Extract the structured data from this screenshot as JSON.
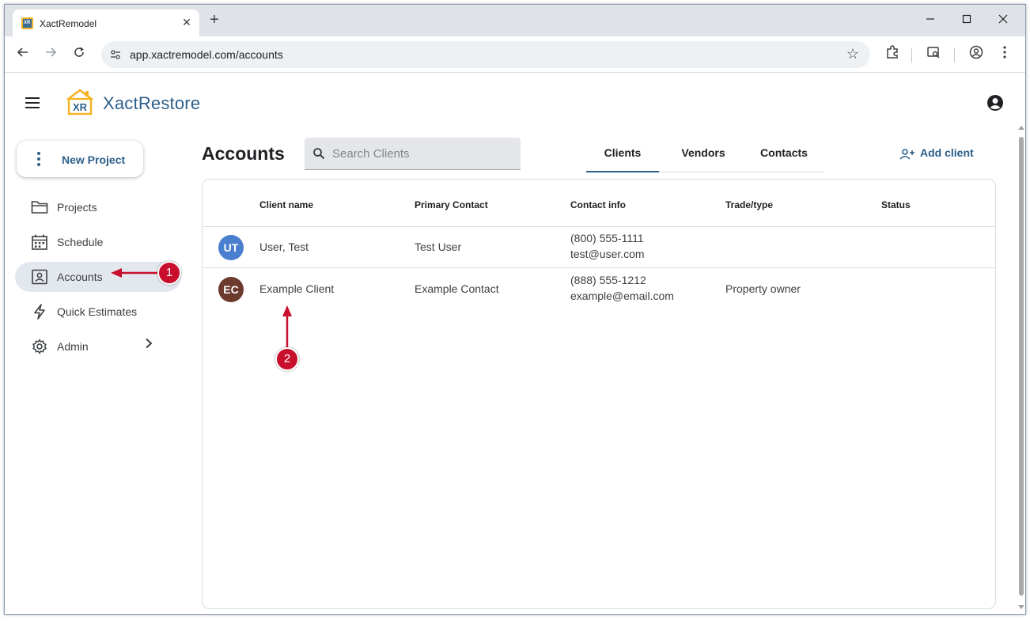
{
  "browser": {
    "tab_title": "XactRemodel",
    "favicon_text": "XR",
    "tab_close": "✕",
    "new_tab": "+",
    "url": "app.xactremodel.com/accounts",
    "window_controls": {
      "minimize": "—",
      "maximize": "☐",
      "close": "✕"
    }
  },
  "app": {
    "logo_text": "XR",
    "brand": "XactRestore",
    "accent_color": "#2c5f8a",
    "logo_color": "#f4b323"
  },
  "sidebar": {
    "new_project": "New Project",
    "items": [
      {
        "label": "Projects",
        "icon": "folder-icon"
      },
      {
        "label": "Schedule",
        "icon": "calendar-icon"
      },
      {
        "label": "Accounts",
        "icon": "contact-card-icon",
        "active": true
      },
      {
        "label": "Quick Estimates",
        "icon": "bolt-icon"
      },
      {
        "label": "Admin",
        "icon": "gear-icon",
        "chevron": "›"
      }
    ]
  },
  "page": {
    "title": "Accounts",
    "search_placeholder": "Search Clients",
    "tabs": [
      "Clients",
      "Vendors",
      "Contacts"
    ],
    "active_tab": "Clients",
    "add_client": "Add client"
  },
  "table": {
    "columns": [
      "Client name",
      "Primary Contact",
      "Contact info",
      "Trade/type",
      "Status"
    ],
    "rows": [
      {
        "initials": "UT",
        "avatar_color": "#4a7fd0",
        "name": "User, Test",
        "contact": "Test User",
        "phone": "(800) 555-1111",
        "email": "test@user.com",
        "trade": "",
        "status": ""
      },
      {
        "initials": "EC",
        "avatar_color": "#6d3b2e",
        "name": "Example Client",
        "contact": "Example Contact",
        "phone": "(888) 555-1212",
        "email": "example@email.com",
        "trade": "Property owner",
        "status": ""
      }
    ]
  },
  "annotations": {
    "badge1": "1",
    "badge2": "2",
    "color": "#c8102e"
  }
}
